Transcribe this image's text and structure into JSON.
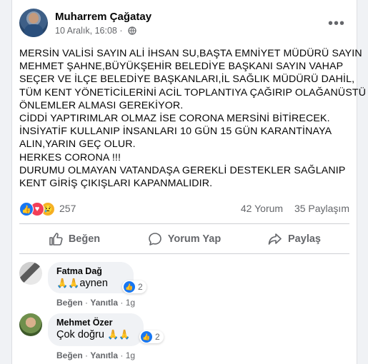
{
  "post": {
    "author": "Muharrem Çağatay",
    "timestamp": "10 Aralık, 16:08",
    "separator": "·",
    "menu_icon": "more-dots-icon",
    "lines": [
      "MERSİN VALİSİ SAYIN ALİ İHSAN SU,BAŞTA EMNİYET MÜDÜRÜ SAYIN",
      "MEHMET ŞAHNE,BÜYÜKŞEHİR BELEDİYE BAŞKANI SAYIN VAHAP",
      "SEÇER VE İLÇE BELEDİYE BAŞKANLARI,İL SAĞLIK MÜDÜRÜ DAHİL,",
      "TÜM KENT YÖNETİCİLERİNİ ACİL TOPLANTIYA ÇAĞIRIP OLAĞANÜSTÜ",
      "ÖNLEMLER ALMASI GEREKİYOR.",
      "CİDDİ YAPTIRIMLAR OLMAZ İSE CORONA MERSİNİ BİTİRECEK.",
      "İNSİYATİF KULLANIP İNSANLARI 10 GÜN 15 GÜN KARANTİNAYA",
      "ALIN,YARIN GEÇ OLUR.",
      "HERKES CORONA !!!",
      "DURUMU OLMAYAN VATANDAŞA GEREKLİ DESTEKLER SAĞLANIP",
      "KENT GİRİŞ ÇIKIŞLARI KAPANMALIDIR."
    ]
  },
  "stats": {
    "reaction_count": "257",
    "comments": "42 Yorum",
    "shares": "35 Paylaşım"
  },
  "actions": {
    "like": "Beğen",
    "comment": "Yorum Yap",
    "share": "Paylaş"
  },
  "comments": [
    {
      "name": "Fatma Dağ",
      "text": "aynen",
      "emoji": "🙏🙏",
      "reactions": "2",
      "like": "Beğen",
      "reply": "Yanıtla",
      "dot": "·",
      "age": "1g"
    },
    {
      "name": "Mehmet Özer",
      "text": "Çok doğru",
      "emoji": "🙏🙏",
      "reactions": "2",
      "like": "Beğen",
      "reply": "Yanıtla",
      "dot": "·",
      "age": "1g"
    }
  ],
  "colors": {
    "accent": "#1877f2",
    "love": "#f33e58",
    "muted": "#65676b"
  }
}
